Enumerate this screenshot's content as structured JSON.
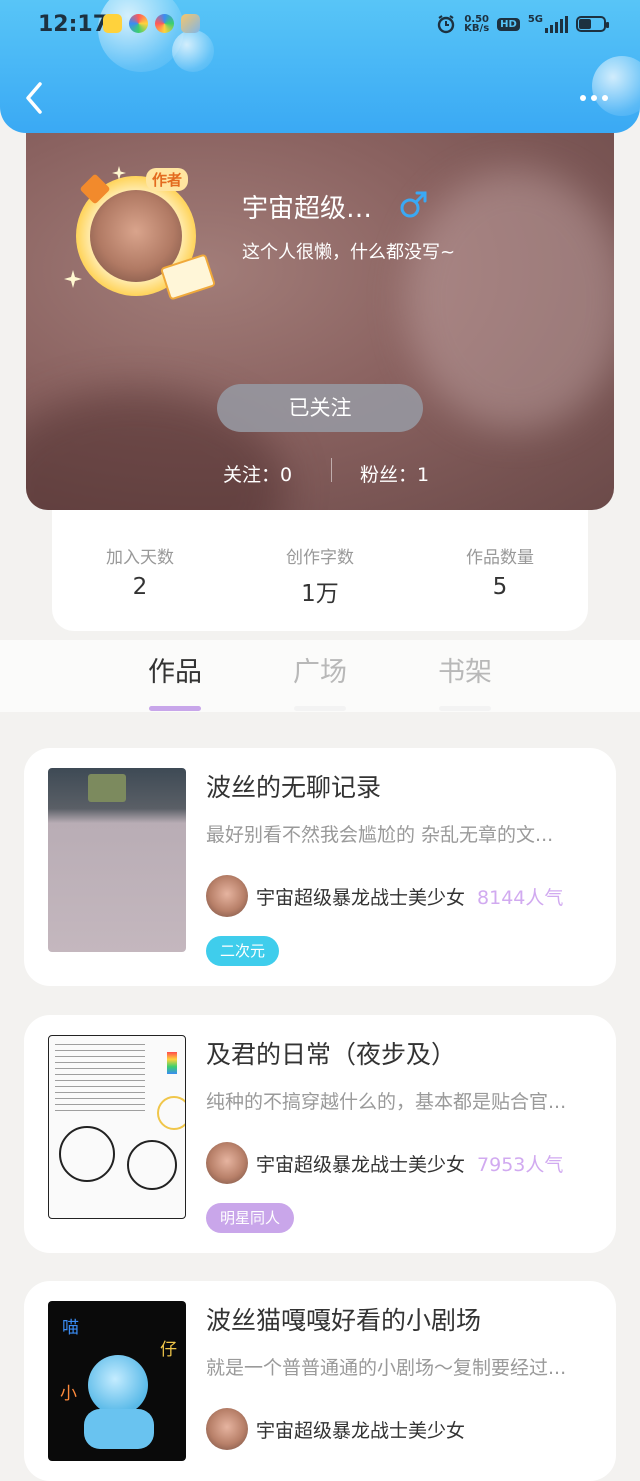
{
  "status_bar": {
    "time": "12:17",
    "net_speed_value": "0.50",
    "net_speed_unit": "KB/s",
    "hd_label": "HD",
    "network_type": "5G"
  },
  "header": {
    "back_icon": "chevron-left-icon",
    "more_icon": "more-dots-icon",
    "color_top": "#58c5f7",
    "color_bottom": "#3aa9f4"
  },
  "profile": {
    "author_badge": "作者",
    "nickname": "宇宙超级…",
    "gender_icon": "male-symbol-icon",
    "gender_color": "#3aa9f4",
    "bio": "这个人很懒，什么都没写~",
    "follow_button_label": "已关注",
    "follow_label": "关注：",
    "follow_count": "0",
    "fans_label": "粉丝：",
    "fans_count": "1"
  },
  "stats": [
    {
      "label": "加入天数",
      "value": "2"
    },
    {
      "label": "创作字数",
      "value": "1万"
    },
    {
      "label": "作品数量",
      "value": "5"
    }
  ],
  "tabs": [
    {
      "label": "作品",
      "active": true
    },
    {
      "label": "广场",
      "active": false
    },
    {
      "label": "书架",
      "active": false
    }
  ],
  "works": [
    {
      "title": "波丝的无聊记录",
      "description": "最好别看不然我会尴尬的 杂乱无章的文...",
      "author": "宇宙超级暴龙战士美少女",
      "popularity": "8144人气",
      "tag": "二次元",
      "tag_color": "#3fcdec"
    },
    {
      "title": "及君的日常（夜步及）",
      "description": "纯种的不搞穿越什么的，基本都是贴合官...",
      "author": "宇宙超级暴龙战士美少女",
      "popularity": "7953人气",
      "tag": "明星同人",
      "tag_color": "#c9a6ea"
    },
    {
      "title": "波丝猫嘎嘎好看的小剧场",
      "description": "就是一个普普通通的小剧场～复制要经过...",
      "author": "宇宙超级暴龙战士美少女",
      "popularity": "",
      "tag": "",
      "tag_color": "#3fcdec",
      "cover_text_1": "喵",
      "cover_text_2": "仔",
      "cover_text_3": "小"
    }
  ],
  "colors": {
    "accent_purple": "#c8a6ea",
    "popularity_purple": "#d1aaf0",
    "page_background": "#f3f2f0"
  }
}
